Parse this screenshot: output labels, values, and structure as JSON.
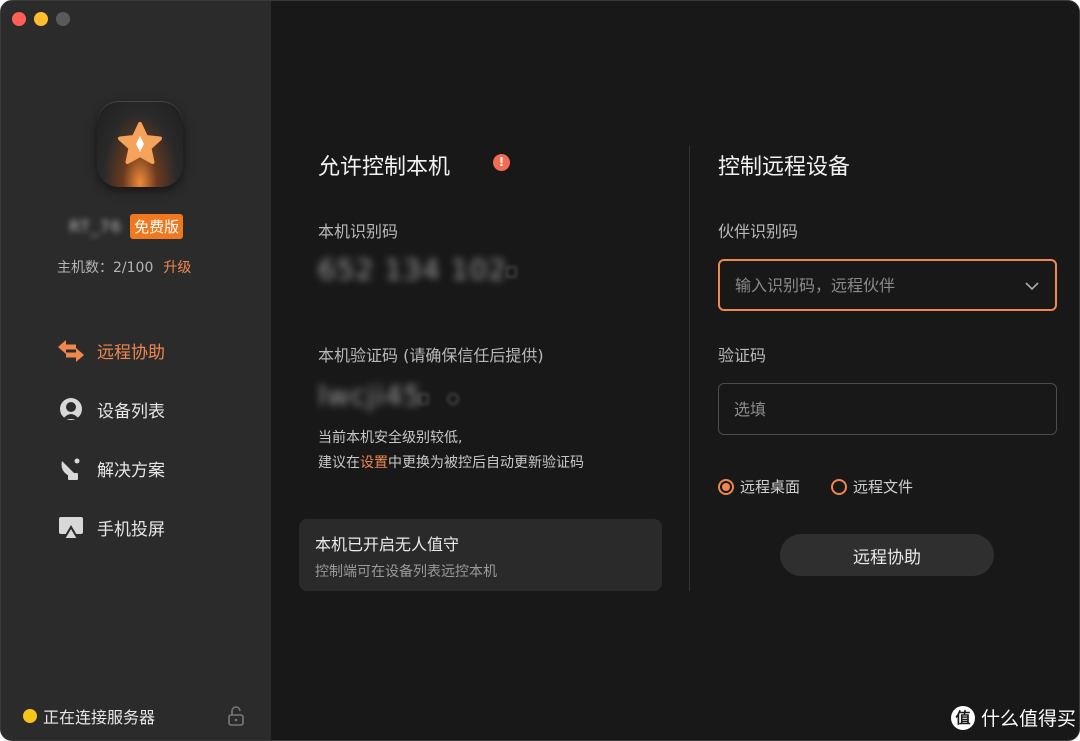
{
  "window": {
    "traffic_lights": [
      "close",
      "minimize",
      "zoom"
    ]
  },
  "sidebar": {
    "username": "RT_76",
    "plan_badge": "免费版",
    "hosts_label": "主机数：2/100",
    "upgrade_label": "升级",
    "nav_items": [
      {
        "label": "远程协助",
        "icon": "swap-arrows-icon",
        "active": true
      },
      {
        "label": "设备列表",
        "icon": "device-list-icon",
        "active": false
      },
      {
        "label": "解决方案",
        "icon": "satellite-dish-icon",
        "active": false
      },
      {
        "label": "手机投屏",
        "icon": "screen-cast-icon",
        "active": false
      }
    ],
    "status_text": "正在连接服务器",
    "status_color": "#f5c518"
  },
  "allow_control": {
    "title": "允许控制本机",
    "device_code_label": "本机识别码",
    "device_code_value": "652 134 102",
    "verify_code_label": "本机验证码 (请确保信任后提供)",
    "verify_code_value": "lwcji45",
    "note_line1": "当前本机安全级别较低,",
    "note_line2_prefix": "建议在",
    "note_line2_link": "设置",
    "note_line2_suffix": "中更换为被控后自动更新验证码",
    "unattended_title": "本机已开启无人值守",
    "unattended_desc": "控制端可在设备列表远控本机"
  },
  "remote_control": {
    "title": "控制远程设备",
    "partner_label": "伙伴识别码",
    "partner_placeholder": "输入识别码，远程伙伴",
    "verify_label": "验证码",
    "verify_placeholder": "选填",
    "options": [
      {
        "label": "远程桌面",
        "checked": true
      },
      {
        "label": "远程文件",
        "checked": false
      }
    ],
    "connect_button": "远程协助"
  },
  "watermark": {
    "logo": "值",
    "text": "什么值得买"
  },
  "colors": {
    "accent": "#f0874d",
    "badge": "#f0781e",
    "warning": "#f26b52"
  }
}
